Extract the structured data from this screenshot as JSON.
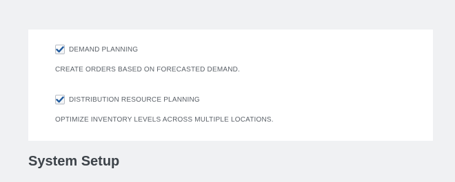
{
  "options": [
    {
      "label": "DEMAND PLANNING",
      "description": "CREATE ORDERS BASED ON FORECASTED DEMAND.",
      "checked": true
    },
    {
      "label": "DISTRIBUTION RESOURCE PLANNING",
      "description": "OPTIMIZE INVENTORY LEVELS ACROSS MULTIPLE LOCATIONS.",
      "checked": true
    }
  ],
  "section": {
    "title": "System Setup"
  },
  "icons": {
    "checkbox": "checkmark-icon"
  },
  "colors": {
    "page_background": "#f0f1f3",
    "card_background": "#ffffff",
    "check_color": "#1f5a9e",
    "text_color": "#5b6168",
    "title_color": "#3d4349"
  }
}
